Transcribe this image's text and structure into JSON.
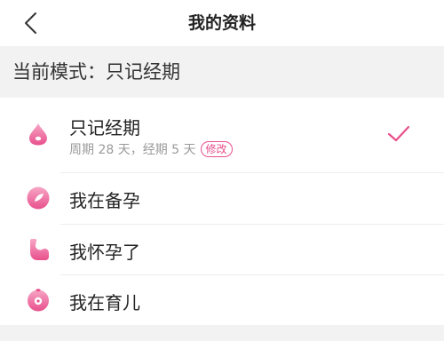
{
  "header": {
    "title": "我的资料",
    "back_icon": "chevron-left-icon"
  },
  "mode": {
    "text": "当前模式：只记经期"
  },
  "options": [
    {
      "label": "只记经期",
      "detail": "周期 28 天，经期 5 天",
      "edit_label": "修改",
      "icon": "droplet-icon",
      "selected": true
    },
    {
      "label": "我在备孕",
      "icon": "seed-icon",
      "selected": false
    },
    {
      "label": "我怀孕了",
      "icon": "pregnant-icon",
      "selected": false
    },
    {
      "label": "我在育儿",
      "icon": "baby-icon",
      "selected": false
    }
  ],
  "colors": {
    "accent": "#e84f8c",
    "icon_light": "#f3a0c0",
    "background_gray": "#f2f2f2"
  }
}
